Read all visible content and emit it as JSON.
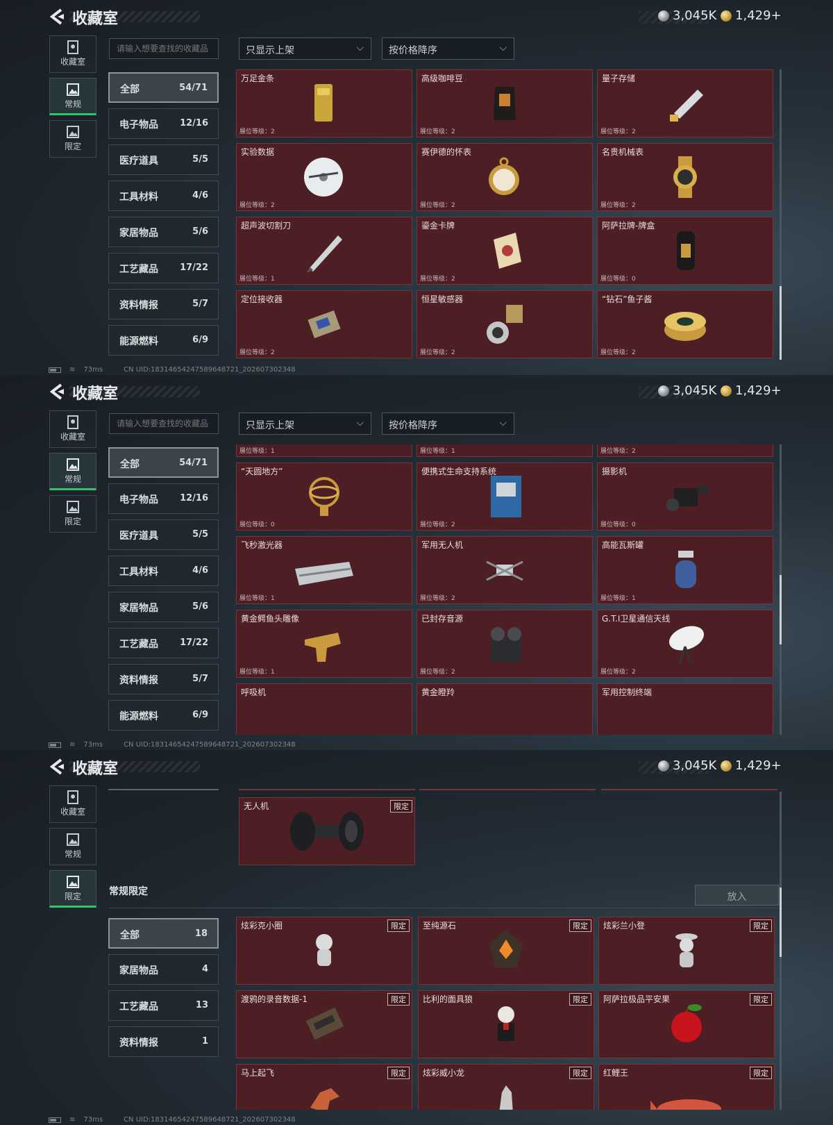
{
  "header": {
    "title": "收藏室",
    "silver": "3,045K",
    "gold": "1,429+"
  },
  "side_tabs": [
    "收藏室",
    "常规",
    "限定"
  ],
  "search": {
    "placeholder": "请输入想要查找的收藏品"
  },
  "filters": {
    "display": "只显示上架",
    "sort": "按价格降序"
  },
  "categories": [
    {
      "name": "全部",
      "count": "54/71"
    },
    {
      "name": "电子物品",
      "count": "12/16"
    },
    {
      "name": "医疗道具",
      "count": "5/5"
    },
    {
      "name": "工具材料",
      "count": "4/6"
    },
    {
      "name": "家居物品",
      "count": "5/6"
    },
    {
      "name": "工艺藏品",
      "count": "17/22"
    },
    {
      "name": "资料情报",
      "count": "5/7"
    },
    {
      "name": "能源燃料",
      "count": "6/9"
    }
  ],
  "limited_categories": [
    {
      "name": "全部",
      "count": "18"
    },
    {
      "name": "家居物品",
      "count": "4"
    },
    {
      "name": "工艺藏品",
      "count": "13"
    },
    {
      "name": "资料情报",
      "count": "1"
    }
  ],
  "level_label": "展位等级：",
  "limited_tag": "限定",
  "panel1_items": [
    {
      "name": "万足金条",
      "level": "2",
      "icon": "gold-bar"
    },
    {
      "name": "高级咖啡豆",
      "level": "2",
      "icon": "coffee-bag"
    },
    {
      "name": "量子存储",
      "level": "2",
      "icon": "usb-drive"
    },
    {
      "name": "实验数据",
      "level": "2",
      "icon": "disc"
    },
    {
      "name": "赛伊德的怀表",
      "level": "2",
      "icon": "pocket-watch"
    },
    {
      "name": "名贵机械表",
      "level": "2",
      "icon": "wrist-watch"
    },
    {
      "name": "超声波切割刀",
      "level": "1",
      "icon": "cutter"
    },
    {
      "name": "鎏金卡牌",
      "level": "2",
      "icon": "card"
    },
    {
      "name": "阿萨拉牌-牌盒",
      "level": "0",
      "icon": "card-box"
    },
    {
      "name": "定位接收器",
      "level": "2",
      "icon": "receiver"
    },
    {
      "name": "恒星敏感器",
      "level": "2",
      "icon": "sensor"
    },
    {
      "name": "“钻石”鱼子酱",
      "level": "2",
      "icon": "caviar"
    }
  ],
  "panel2_items": [
    {
      "name": "",
      "level": "1",
      "icon": "terminal"
    },
    {
      "name": "",
      "level": "1",
      "icon": "radio"
    },
    {
      "name": "",
      "level": "2",
      "icon": "musket"
    },
    {
      "name": "“天圆地方”",
      "level": "0",
      "icon": "armillary"
    },
    {
      "name": "便携式生命支持系统",
      "level": "2",
      "icon": "life-support"
    },
    {
      "name": "摄影机",
      "level": "0",
      "icon": "camera"
    },
    {
      "name": "飞秒激光器",
      "level": "1",
      "icon": "laser"
    },
    {
      "name": "军用无人机",
      "level": "2",
      "icon": "drone"
    },
    {
      "name": "高能瓦斯罐",
      "level": "1",
      "icon": "gas-tank"
    },
    {
      "name": "黄金鳄鱼头雕像",
      "level": "1",
      "icon": "croc-statue"
    },
    {
      "name": "已封存音源",
      "level": "2",
      "icon": "tape-recorder"
    },
    {
      "name": "G.T.I卫星通信天线",
      "level": "2",
      "icon": "satellite-dish"
    },
    {
      "name": "呼吸机",
      "level": "",
      "icon": ""
    },
    {
      "name": "黄金瞪羚",
      "level": "",
      "icon": ""
    },
    {
      "name": "军用控制终端",
      "level": "",
      "icon": ""
    }
  ],
  "panel3_top_item": {
    "name": "无人机",
    "icon": "rotor-part"
  },
  "panel3_section": {
    "title": "常规限定",
    "button": "放入"
  },
  "panel3_items": [
    {
      "name": "炫彩克小圈",
      "icon": "figurine-white"
    },
    {
      "name": "至纯源石",
      "icon": "crystal"
    },
    {
      "name": "炫彩兰小登",
      "icon": "figurine-hat"
    },
    {
      "name": "渡鸦的录音数据-1",
      "icon": "cassette"
    },
    {
      "name": "比利的面具狼",
      "icon": "puppet"
    },
    {
      "name": "阿萨拉极品平安果",
      "icon": "apple"
    },
    {
      "name": "马上起飞",
      "icon": "horse"
    },
    {
      "name": "炫彩威小龙",
      "icon": "dragon"
    },
    {
      "name": "红鲤王",
      "icon": "carp"
    }
  ],
  "status": {
    "ping": "73ms",
    "uid": "CN UID:18314654247589648721_202607302348"
  },
  "colors": {
    "card_bg": "#4d1f24",
    "accent_green": "#31c46f"
  }
}
